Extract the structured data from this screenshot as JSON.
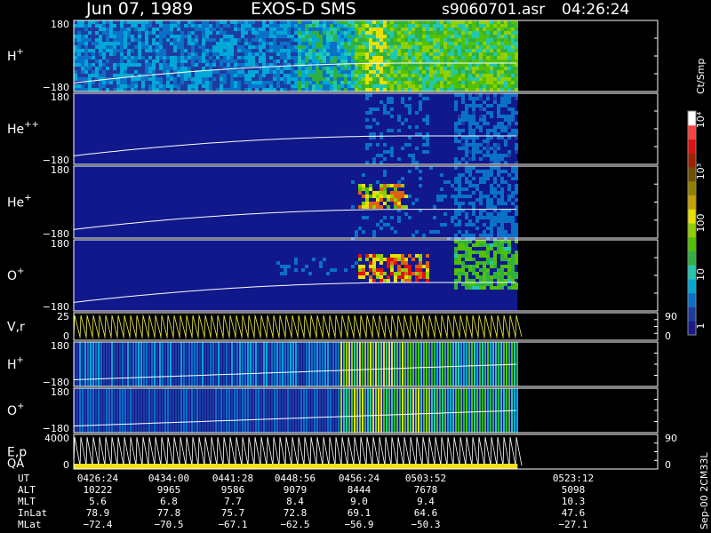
{
  "header": {
    "date": "Jun 07, 1989",
    "instrument": "EXOS-D SMS",
    "file": "s9060701.asr",
    "time": "04:26:24"
  },
  "side_label": "Sep-00 2CM33L",
  "colorbar": {
    "unit": "Ct/Smp",
    "ticks": [
      "1",
      "10",
      "100",
      "10³",
      "10⁴"
    ],
    "colors": [
      "#1a1a8c",
      "#1e3ca0",
      "#0a70c8",
      "#00a8d8",
      "#20c8b0",
      "#30b040",
      "#50c000",
      "#90d000",
      "#e8e000",
      "#c8a000",
      "#908000",
      "#705000",
      "#a02000",
      "#e01010",
      "#ff4040",
      "#ffffff"
    ]
  },
  "panels": [
    {
      "label": "H",
      "sup": "+",
      "ymax": "180",
      "ymin": "−180"
    },
    {
      "label": "He",
      "sup": "++",
      "ymax": "180",
      "ymin": "−180"
    },
    {
      "label": "He",
      "sup": "+",
      "ymax": "180",
      "ymin": "−180"
    },
    {
      "label": "O",
      "sup": "+",
      "ymax": "180",
      "ymin": "−180"
    },
    {
      "label": "V,r",
      "sup": "",
      "ymax": "25",
      "ymin": "0",
      "rmax": "90",
      "rmin": "0"
    },
    {
      "label": "H",
      "sup": "+",
      "ymax": "180",
      "ymin": "−180"
    },
    {
      "label": "O",
      "sup": "+",
      "ymax": "180",
      "ymin": "−180"
    },
    {
      "label": "E,p",
      "sup": "",
      "label2": "QA",
      "ymax": "4000",
      "ymin": "0",
      "rmax": "90",
      "rmin": "0"
    }
  ],
  "chart_data": {
    "type": "heatmap",
    "x_labels": [
      "0426:24",
      "0434:00",
      "0441:28",
      "0448:56",
      "0456:24",
      "0503:52",
      "0523:12"
    ],
    "rows": [
      {
        "name": "UT",
        "values": [
          "0426:24",
          "0434:00",
          "0441:28",
          "0448:56",
          "0456:24",
          "0503:52",
          "0523:12"
        ]
      },
      {
        "name": "ALT",
        "values": [
          "10222",
          "9965",
          "9586",
          "9079",
          "8444",
          "7678",
          "5098"
        ]
      },
      {
        "name": "MLT",
        "values": [
          "5.6",
          "6.8",
          "7.7",
          "8.4",
          "9.0",
          "9.4",
          "10.3"
        ]
      },
      {
        "name": "InLat",
        "values": [
          "78.9",
          "77.8",
          "75.7",
          "72.8",
          "69.1",
          "64.6",
          "47.6"
        ]
      },
      {
        "name": "MLat",
        "values": [
          "−72.4",
          "−70.5",
          "−67.1",
          "−62.5",
          "−56.9",
          "−50.3",
          "−27.1"
        ]
      }
    ],
    "data_end_fraction": 0.76
  }
}
